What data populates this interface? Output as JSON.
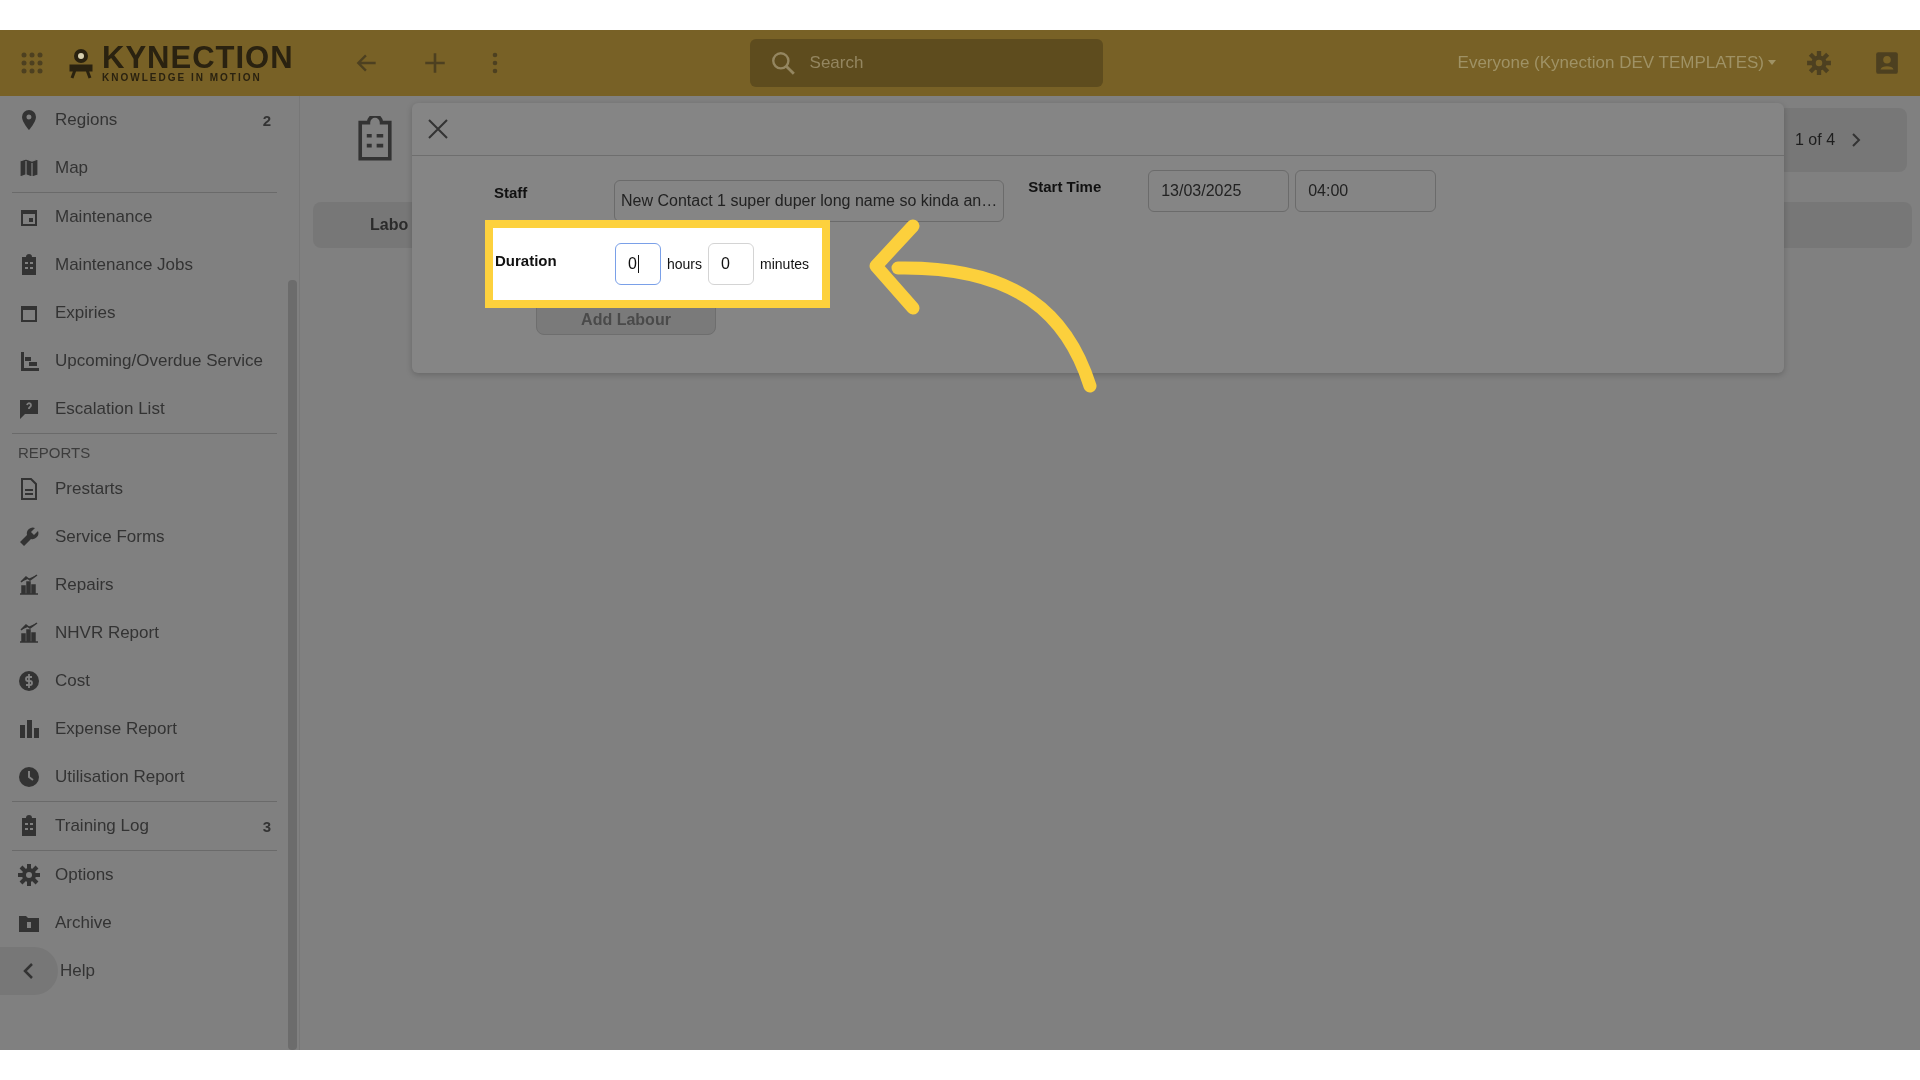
{
  "header": {
    "logo": {
      "name": "KYNECTION",
      "tagline": "KNOWLEDGE IN MOTION"
    },
    "search": {
      "placeholder": "Search"
    },
    "account": "Everyone (Kynection DEV TEMPLATES)"
  },
  "sidebar": {
    "groups": [
      {
        "items": [
          {
            "label": "Regions",
            "count": "2"
          },
          {
            "label": "Map"
          }
        ]
      },
      {
        "items": [
          {
            "label": "Maintenance"
          },
          {
            "label": "Maintenance Jobs"
          },
          {
            "label": "Expiries"
          },
          {
            "label": "Upcoming/Overdue Service"
          },
          {
            "label": "Escalation List"
          }
        ]
      },
      {
        "heading": "REPORTS",
        "items": [
          {
            "label": "Prestarts"
          },
          {
            "label": "Service Forms"
          },
          {
            "label": "Repairs"
          },
          {
            "label": "NHVR Report"
          },
          {
            "label": "Cost"
          },
          {
            "label": "Expense Report"
          },
          {
            "label": "Utilisation Report"
          }
        ]
      },
      {
        "items": [
          {
            "label": "Training Log",
            "count": "3"
          }
        ]
      },
      {
        "items": [
          {
            "label": "Options"
          },
          {
            "label": "Archive"
          },
          {
            "label": "Help"
          }
        ]
      }
    ]
  },
  "page": {
    "tab": "Labo",
    "pager": "1 of 4"
  },
  "dialog": {
    "staff": {
      "label": "Staff",
      "value": "New Contact 1 super duper long name so kinda an…"
    },
    "start_time": {
      "label": "Start Time",
      "date": "13/03/2025",
      "time": "04:00"
    },
    "duration": {
      "label": "Duration",
      "hours": {
        "value": "0",
        "unit": "hours",
        "focused": true
      },
      "minutes": {
        "value": "0",
        "unit": "minutes",
        "focused": false
      }
    },
    "add_button": "Add Labour"
  }
}
